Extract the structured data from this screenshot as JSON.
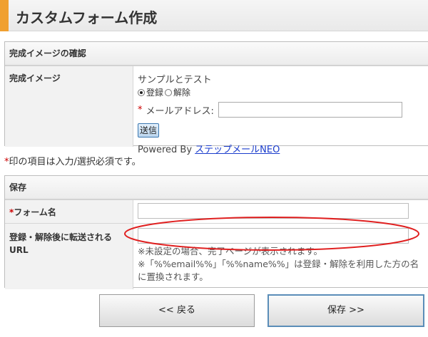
{
  "page": {
    "title": "カスタムフォーム作成"
  },
  "confirm_section": {
    "header": "完成イメージの確認",
    "label": "完成イメージ",
    "preview": {
      "form_title": "サンプルとテスト",
      "radio_register": "登録",
      "radio_cancel": "解除",
      "required_mark": "*",
      "email_label": "メールアドレス:",
      "email_value": "",
      "submit_label": "送信",
      "powered_prefix": "Powered By ",
      "powered_link": "ステップメールNEO"
    }
  },
  "required_note": {
    "mark": "*",
    "text": "印の項目は入力/選択必須です。"
  },
  "save_section": {
    "header": "保存",
    "form_name_label": "フォーム名",
    "form_name_required": "*",
    "form_name_value": "",
    "redirect_label": "登録・解除後に転送されるURL",
    "redirect_value": "",
    "hint1": "※未設定の場合、完了ページが表示されます。",
    "hint2": "※「%%email%%」「%%name%%」は登録・解除を利用した方の名に置換されます。"
  },
  "buttons": {
    "back": "<< 戻る",
    "save": "保存 >>"
  },
  "colors": {
    "accent": "#f0a030",
    "annotation": "#e02020",
    "link": "#1a3ccc",
    "required": "#cc0000"
  }
}
